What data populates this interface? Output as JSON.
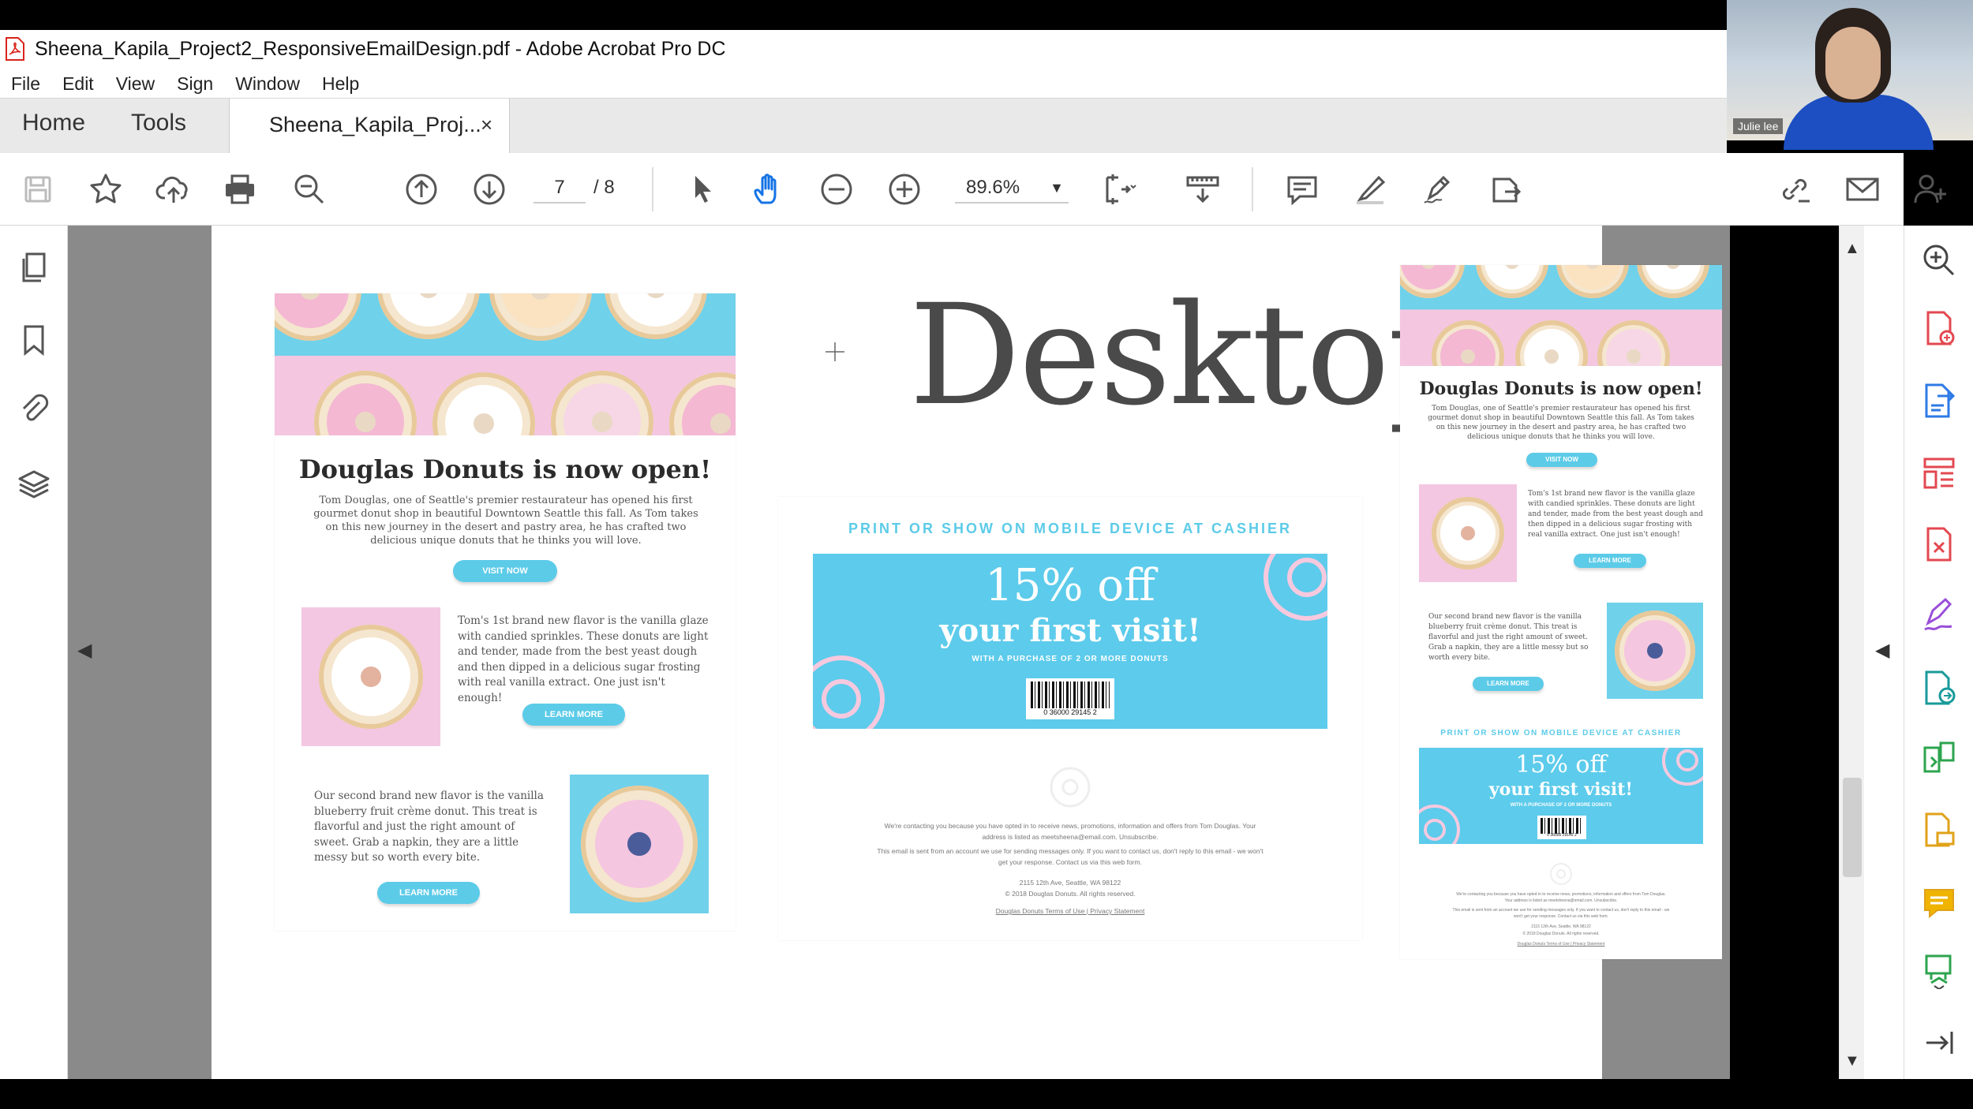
{
  "window": {
    "title": "Sheena_Kapila_Project2_ResponsiveEmailDesign.pdf - Adobe Acrobat Pro DC"
  },
  "menu": [
    "File",
    "Edit",
    "View",
    "Sign",
    "Window",
    "Help"
  ],
  "tabs": {
    "home": "Home",
    "tools": "Tools",
    "document": "Sheena_Kapila_Proj...",
    "close": "×"
  },
  "toolbar": {
    "page_current": "7",
    "page_total": "/ 8",
    "zoom": "89.6%",
    "icons": [
      "save-icon",
      "star-icon",
      "upload-cloud-icon",
      "print-icon",
      "search-zoom-icon",
      "page-up-icon",
      "page-down-icon",
      "select-cursor-icon",
      "hand-tool-icon",
      "zoom-out-icon",
      "zoom-in-icon",
      "fit-page-icon",
      "scroll-mode-icon",
      "comment-icon",
      "highlight-icon",
      "sign-icon",
      "send-for-review-icon",
      "share-link-icon",
      "email-icon",
      "add-user-icon"
    ]
  },
  "webcam": {
    "name": "Julie lee"
  },
  "pdf": {
    "heading": "Desktop",
    "email": {
      "headline": "Douglas Donuts is now open!",
      "intro": "Tom Douglas, one of Seattle's premier restaurateur has opened his first gourmet donut shop in beautiful Downtown Seattle this fall. As Tom takes on this new journey in the desert and pastry area, he has crafted two delicious unique donuts that he thinks you will love.",
      "visit_button": "VISIT NOW",
      "flavor1": "Tom's 1st brand new flavor is the vanilla glaze with candied sprinkles. These donuts are light and tender, made from the best yeast dough and then dipped in a delicious sugar frosting with real vanilla extract. One just isn't enough!",
      "flavor2": "Our second brand new flavor is the vanilla blueberry fruit crème donut. This treat is flavorful and just the right amount of sweet. Grab a napkin, they are a little messy but so worth every bite.",
      "learn_button": "LEARN MORE"
    },
    "coupon": {
      "cashier": "PRINT OR SHOW ON MOBILE DEVICE AT CASHIER",
      "percent": "15% off",
      "visit": "your first visit!",
      "fine": "WITH A PURCHASE OF 2 OR MORE DONUTS",
      "barcode_nums": "0  36000  29145  2"
    },
    "footer": {
      "line1": "We're contacting you because you have opted in to receive news, promotions, information and offers from Tom Douglas. Your address is listed as meetsheena@email.com. Unsubscribe.",
      "line2": "This email is sent from an account we use for sending messages only. If you want to contact us, don't reply to this email - we won't get your response. Contact us via this web form.",
      "address": "2115 12th Ave, Seattle, WA 98122",
      "copyright": "© 2018 Douglas Donuts. All rights reserved.",
      "links": "Douglas Donuts Terms of Use  |  Privacy Statement"
    }
  },
  "colors": {
    "accent": "#5ccbe8",
    "pink": "#f4b8d3",
    "canvas_gray": "#8a8a8a",
    "acrobat_red": "#d8241c"
  }
}
